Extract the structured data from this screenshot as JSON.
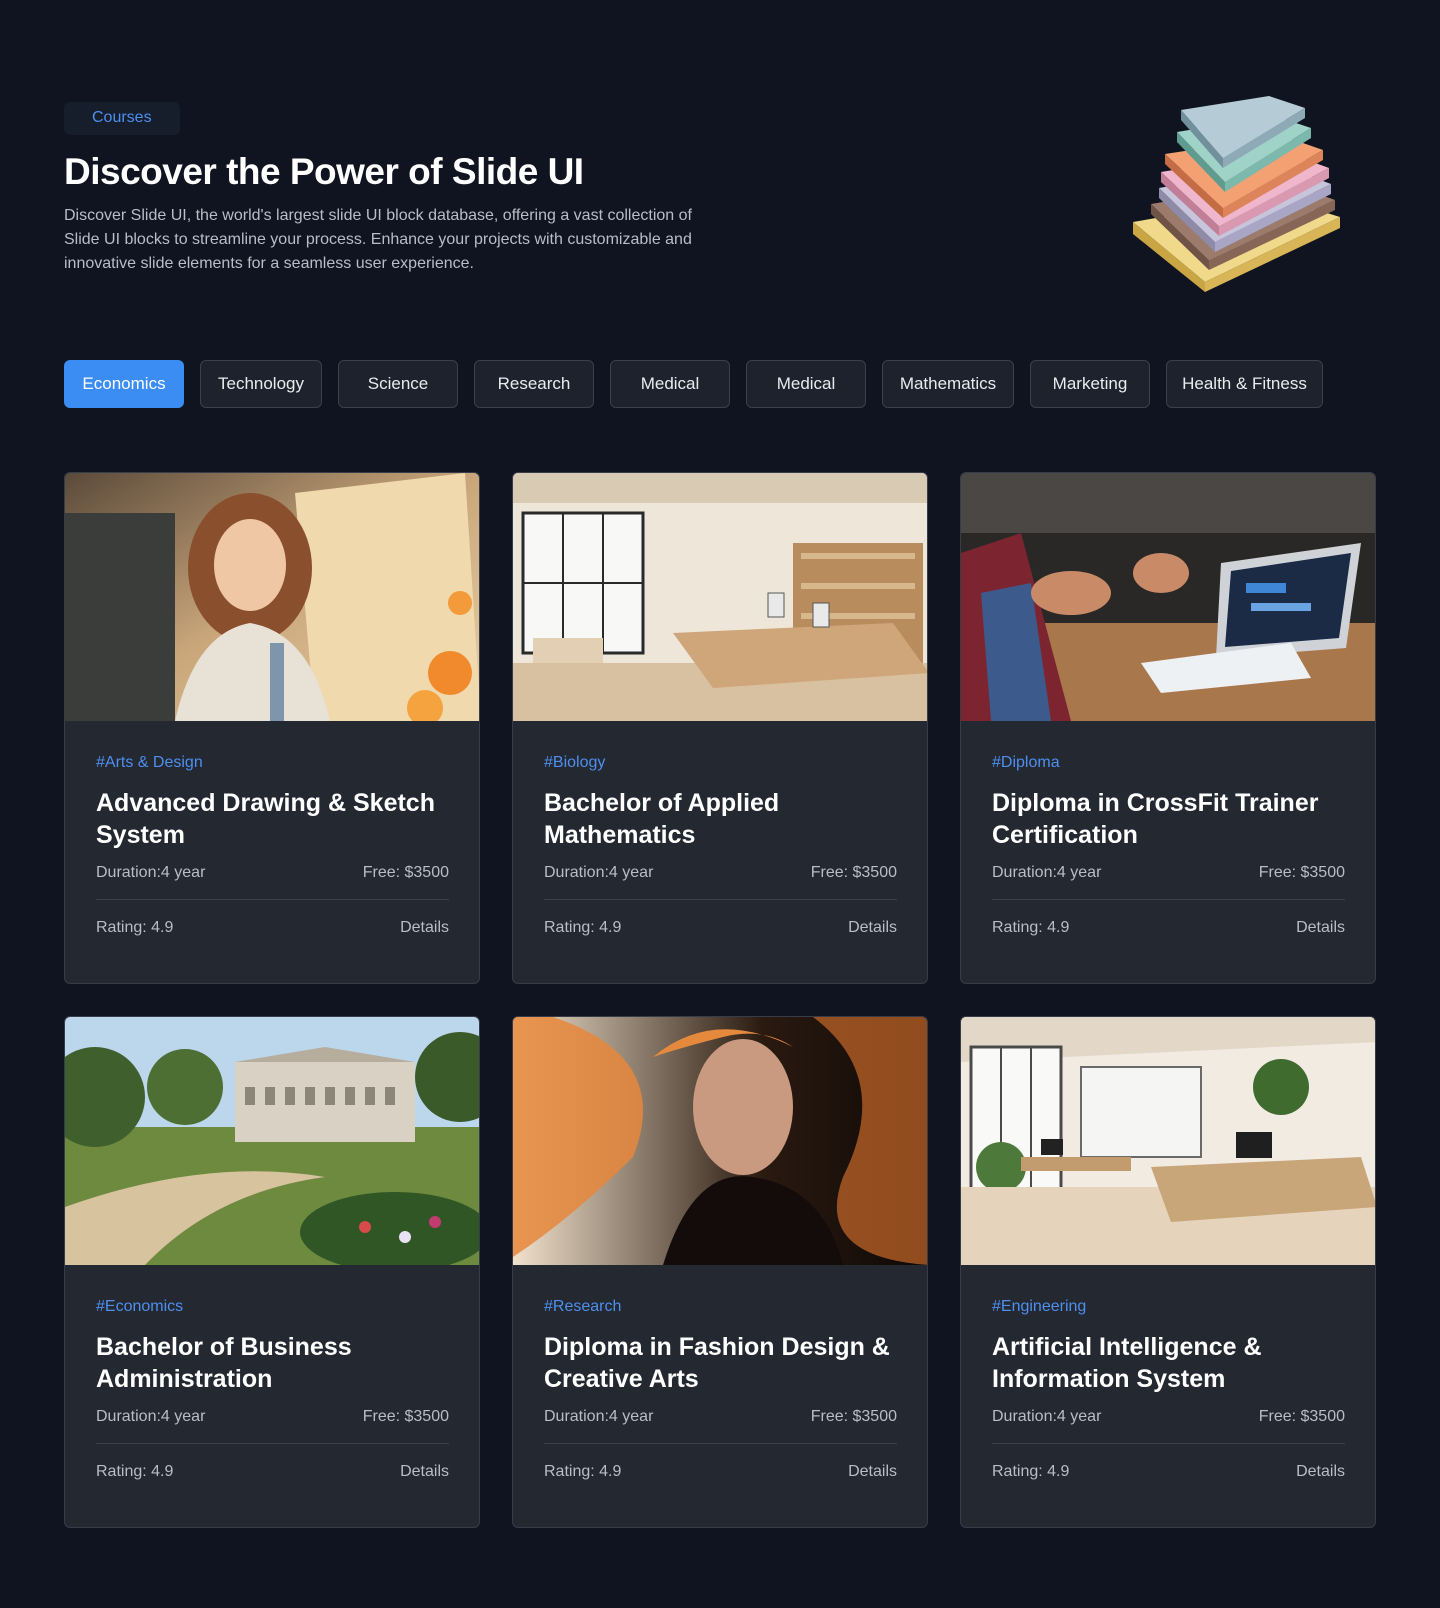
{
  "hero": {
    "badge": "Courses",
    "title": "Discover the Power of Slide UI",
    "description": "Discover Slide UI, the world's largest slide UI block database, offering a vast collection of Slide UI blocks to streamline your process. Enhance your projects with customizable and innovative slide elements for a seamless user experience."
  },
  "filters": [
    {
      "label": "Economics",
      "active": true
    },
    {
      "label": "Technology",
      "active": false
    },
    {
      "label": "Science",
      "active": false
    },
    {
      "label": "Research",
      "active": false
    },
    {
      "label": "Medical",
      "active": false
    },
    {
      "label": "Medical",
      "active": false
    },
    {
      "label": "Mathematics",
      "active": false
    },
    {
      "label": "Marketing",
      "active": false
    },
    {
      "label": "Health & Fitness",
      "active": false
    }
  ],
  "courses": [
    {
      "tag": "#Arts & Design",
      "title": "Advanced Drawing & Sketch System",
      "duration": "Duration:4 year",
      "fee": "Free: $3500",
      "rating": "Rating: 4.9",
      "details": "Details",
      "image": "woman-painting-photo"
    },
    {
      "tag": "#Biology",
      "title": "Bachelor of Applied Mathematics",
      "duration": "Duration:4 year",
      "fee": "Free: $3500",
      "rating": "Rating: 4.9",
      "details": "Details",
      "image": "bright-office-photo"
    },
    {
      "tag": "#Diploma",
      "title": "Diploma in CrossFit  Trainer Certification",
      "duration": "Duration:4 year",
      "fee": "Free: $3500",
      "rating": "Rating: 4.9",
      "details": "Details",
      "image": "laptop-meeting-photo"
    },
    {
      "tag": "#Economics",
      "title": "Bachelor of Business Administration",
      "duration": "Duration:4 year",
      "fee": "Free: $3500",
      "rating": "Rating: 4.9",
      "details": "Details",
      "image": "garden-mansion-photo"
    },
    {
      "tag": "#Research",
      "title": "Diploma in Fashion Design & Creative Arts",
      "duration": "Duration:4 year",
      "fee": "Free: $3500",
      "rating": "Rating: 4.9",
      "details": "Details",
      "image": "fashion-portrait-photo"
    },
    {
      "tag": "#Engineering",
      "title": "Artificial Intelligence & Information System",
      "duration": "Duration:4 year",
      "fee": "Free: $3500",
      "rating": "Rating: 4.9",
      "details": "Details",
      "image": "open-office-photo"
    }
  ],
  "colors": {
    "background": "#0f1420",
    "card": "#232831",
    "accent": "#3b8cf3",
    "tag": "#4e8ff0"
  }
}
